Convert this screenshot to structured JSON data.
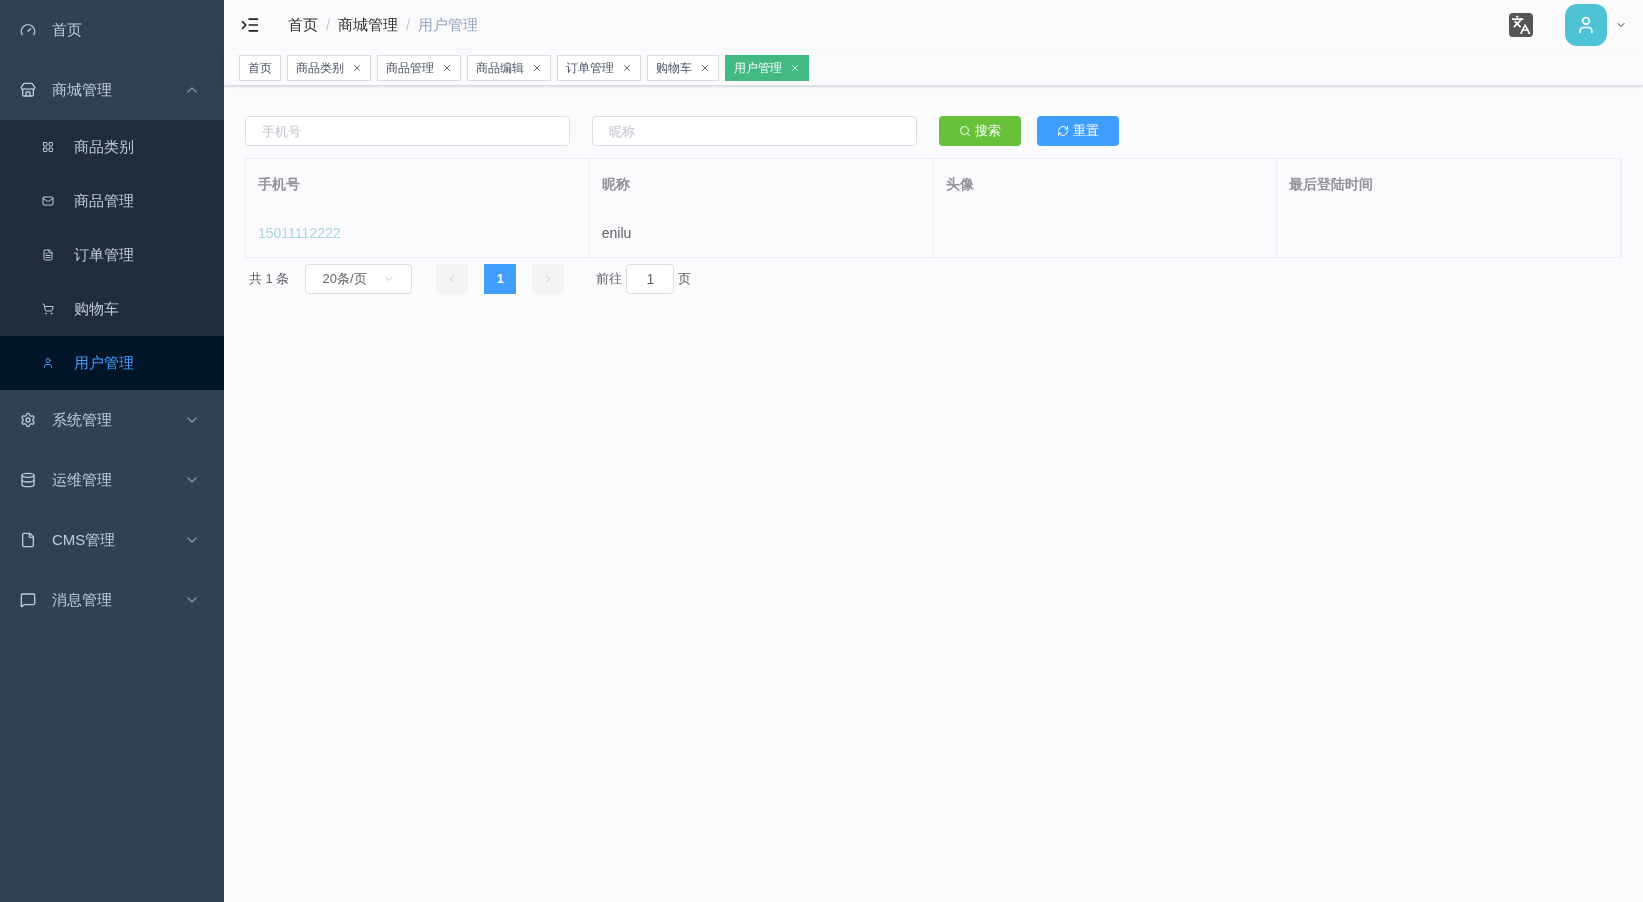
{
  "sidebar": {
    "items": [
      {
        "label": "首页",
        "selected": false
      },
      {
        "label": "商城管理",
        "selected": false,
        "expanded": true,
        "children": [
          {
            "label": "商品类别",
            "selected": false
          },
          {
            "label": "商品管理",
            "selected": false
          },
          {
            "label": "订单管理",
            "selected": false
          },
          {
            "label": "购物车",
            "selected": false
          },
          {
            "label": "用户管理",
            "selected": true
          }
        ]
      },
      {
        "label": "系统管理",
        "selected": false,
        "expanded": false
      },
      {
        "label": "运维管理",
        "selected": false,
        "expanded": false
      },
      {
        "label": "CMS管理",
        "selected": false,
        "expanded": false
      },
      {
        "label": "消息管理",
        "selected": false,
        "expanded": false
      }
    ]
  },
  "breadcrumb": [
    "首页",
    "商城管理",
    "用户管理"
  ],
  "breadcrumb_separator": "/",
  "tabs": [
    {
      "label": "首页",
      "selected": false,
      "closable": false
    },
    {
      "label": "商品类别",
      "selected": false,
      "closable": true
    },
    {
      "label": "商品管理",
      "selected": false,
      "closable": true
    },
    {
      "label": "商品编辑",
      "selected": false,
      "closable": true
    },
    {
      "label": "订单管理",
      "selected": false,
      "closable": true
    },
    {
      "label": "购物车",
      "selected": false,
      "closable": true
    },
    {
      "label": "用户管理",
      "selected": true,
      "closable": true
    }
  ],
  "filters": [
    {
      "placeholder": "手机号"
    },
    {
      "placeholder": "昵称"
    }
  ],
  "buttons": [
    {
      "label": "搜索",
      "kind": "search"
    },
    {
      "label": "重置",
      "kind": "reset"
    }
  ],
  "table": {
    "columns": [
      "手机号",
      "昵称",
      "头像",
      "最后登陆时间"
    ],
    "rows": [
      [
        "15011112222",
        "enilu",
        "",
        ""
      ]
    ]
  },
  "pagination": {
    "total": "共 1 条",
    "page_size": "20条/页",
    "pages": [
      {
        "label": "1",
        "selected": true
      }
    ],
    "goto_label": "前往",
    "goto_value": "1",
    "goto_suffix": "页"
  }
}
